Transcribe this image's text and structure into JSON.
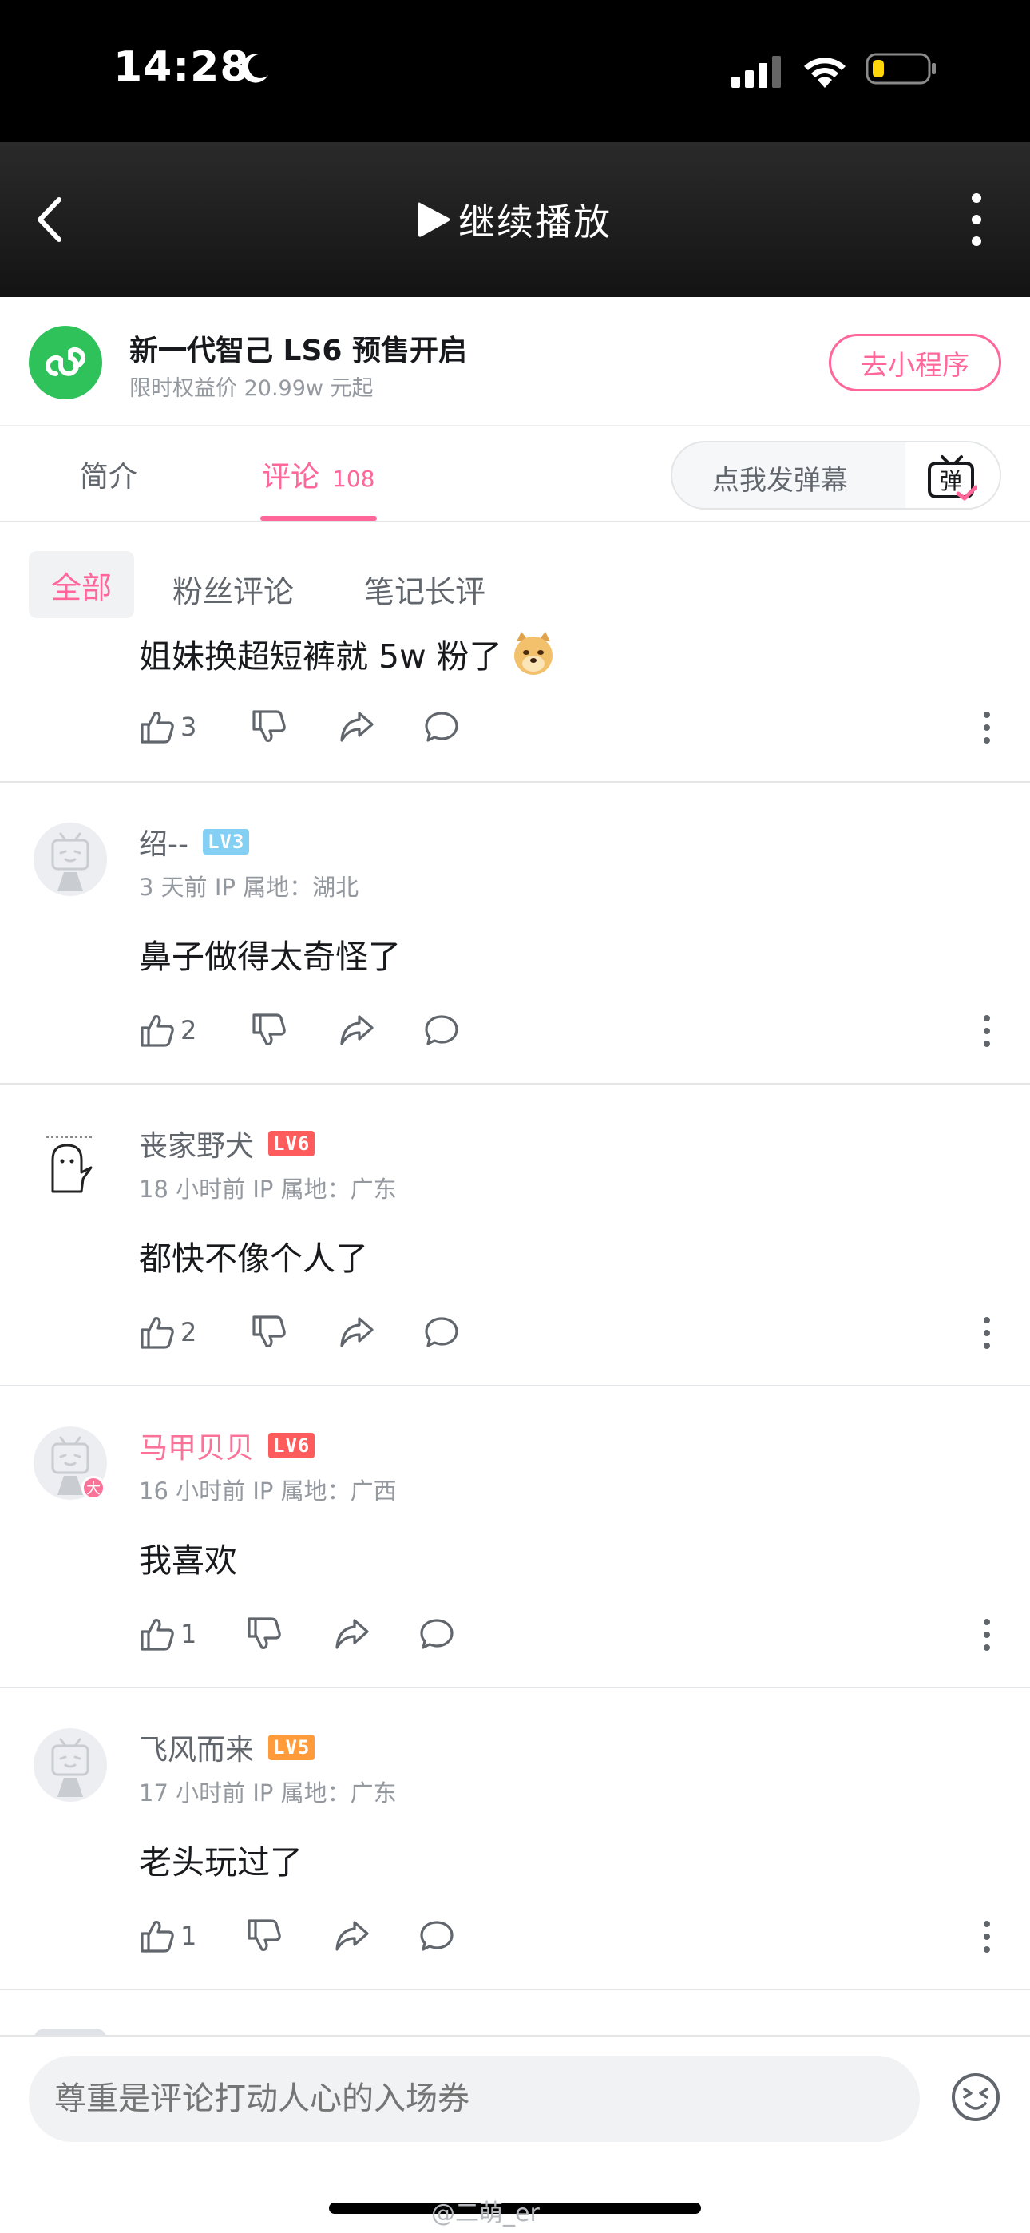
{
  "status_bar": {
    "time": "14:28"
  },
  "nav": {
    "play_label": "继续播放"
  },
  "promo": {
    "title": "新一代智己 LS6 预售开启",
    "subtitle": "限时权益价 20.99w 元起",
    "button": "去小程序"
  },
  "tabs": {
    "intro": "简介",
    "comments": "评论",
    "comments_count": "108",
    "danmaku_placeholder": "点我发弹幕",
    "danmaku_icon_text": "弹"
  },
  "filters": {
    "all": "全部",
    "fans": "粉丝评论",
    "notes": "笔记长评"
  },
  "comments": [
    {
      "text": "姐妹换超短裤就 5w 粉了",
      "likes": "3"
    },
    {
      "user": "绍--",
      "level": "LV3",
      "meta": "3 天前  IP 属地：湖北",
      "text": "鼻子做得太奇怪了",
      "likes": "2"
    },
    {
      "user": "丧家野犬",
      "level": "LV6",
      "meta": "18 小时前  IP 属地：广东",
      "text": "都快不像个人了",
      "likes": "2"
    },
    {
      "user": "马甲贝贝",
      "level": "LV6",
      "badge": "大",
      "meta": "16 小时前  IP 属地：广西",
      "text": "我喜欢",
      "likes": "1"
    },
    {
      "user": "飞风而来",
      "level": "LV5",
      "meta": "17 小时前  IP 属地：广东",
      "text": "老头玩过了",
      "likes": "1"
    }
  ],
  "input": {
    "placeholder": "尊重是评论打动人心的入场券"
  },
  "watermark": "@二萌_er",
  "colors": {
    "accent": "#ff6699",
    "mini_program": "#2fc25b",
    "lv3": "#84d0f5",
    "lv5": "#ff9b3a",
    "lv6": "#fe5c5c"
  }
}
